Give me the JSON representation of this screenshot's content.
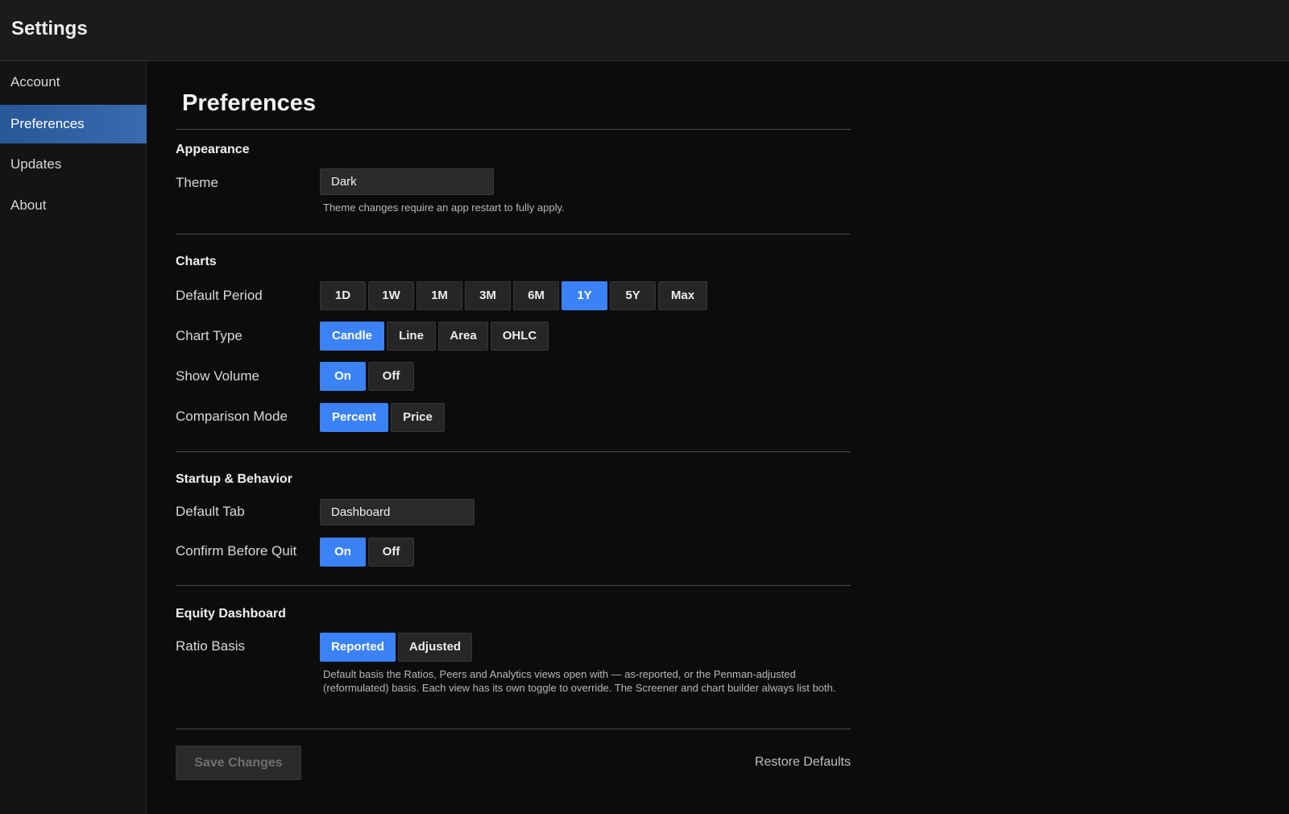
{
  "window": {
    "title": "Settings"
  },
  "sidebar": {
    "items": [
      {
        "label": "Account"
      },
      {
        "label": "Preferences",
        "active": true
      },
      {
        "label": "Updates"
      },
      {
        "label": "About"
      }
    ]
  },
  "page": {
    "title": "Preferences"
  },
  "appearance": {
    "title": "Appearance",
    "theme_label": "Theme",
    "theme_value": "Dark",
    "theme_help": "Theme changes require an app restart to fully apply."
  },
  "charts": {
    "title": "Charts",
    "period_label": "Default Period",
    "periods": [
      "1D",
      "1W",
      "1M",
      "3M",
      "6M",
      "1Y",
      "5Y",
      "Max"
    ],
    "period_selected": "1Y",
    "type_label": "Chart Type",
    "types": [
      "Candle",
      "Line",
      "Area",
      "OHLC"
    ],
    "type_selected": "Candle",
    "volume_label": "Show Volume",
    "volume_options": [
      "On",
      "Off"
    ],
    "volume_selected": "On",
    "comparison_label": "Comparison Mode",
    "comparison_options": [
      "Percent",
      "Price"
    ],
    "comparison_selected": "Percent"
  },
  "startup": {
    "title": "Startup & Behavior",
    "tab_label": "Default Tab",
    "tab_value": "Dashboard",
    "quit_label": "Confirm Before Quit",
    "quit_options": [
      "On",
      "Off"
    ],
    "quit_selected": "On"
  },
  "equity": {
    "title": "Equity Dashboard",
    "ratio_label": "Ratio Basis",
    "ratio_options": [
      "Reported",
      "Adjusted"
    ],
    "ratio_selected": "Reported",
    "ratio_help": "Default basis the Ratios, Peers and Analytics views open with — as-reported, or the Penman-adjusted (reformulated) basis. Each view has its own toggle to override. The Screener and chart builder always list both."
  },
  "footer": {
    "save_label": "Save Changes",
    "restore_label": "Restore Defaults"
  },
  "colors": {
    "accent": "#3b82f6",
    "sidebar_active": "#2f62a6",
    "background": "#0c0c0c"
  }
}
